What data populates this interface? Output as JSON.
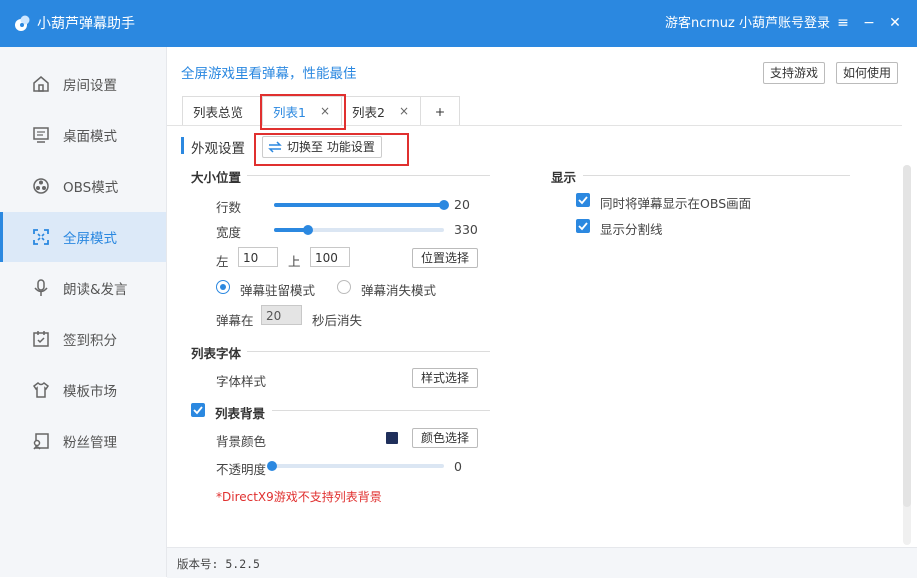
{
  "titlebar": {
    "app_title": "小葫芦弹幕助手",
    "user_name": "游客ncrnuz",
    "login_link": "小葫芦账号登录",
    "menu_glyph": "≡",
    "minimize_glyph": "−",
    "close_glyph": "✕",
    "bg_color": "#2b88e0"
  },
  "sidebar": {
    "items": [
      {
        "label": "房间设置",
        "icon": "house-icon"
      },
      {
        "label": "桌面模式",
        "icon": "monitor-icon"
      },
      {
        "label": "OBS模式",
        "icon": "obs-icon"
      },
      {
        "label": "全屏模式",
        "icon": "fullscreen-icon",
        "active": true
      },
      {
        "label": "朗读&发言",
        "icon": "microphone-icon"
      },
      {
        "label": "签到积分",
        "icon": "calendar-check-icon"
      },
      {
        "label": "模板市场",
        "icon": "tshirt-icon"
      },
      {
        "label": "粉丝管理",
        "icon": "fan-card-icon"
      }
    ]
  },
  "main": {
    "headline": "全屏游戏里看弹幕，性能最佳",
    "support_games_btn": "支持游戏",
    "how_to_use_btn": "如何使用",
    "tabs": [
      {
        "label": "列表总览"
      },
      {
        "label": "列表1",
        "closable": true,
        "active": true
      },
      {
        "label": "列表2",
        "closable": true
      },
      {
        "label": "+"
      }
    ],
    "tab_close_glyph": "×",
    "section_title": "外观设置",
    "switch_btn": "切换至 功能设置",
    "size_position": {
      "title": "大小位置",
      "rows_label": "行数",
      "rows_value": "20",
      "rows_fraction": 1.0,
      "width_label": "宽度",
      "width_value": "330",
      "width_fraction": 0.2,
      "left_label": "左",
      "left_value": "10",
      "top_label": "上",
      "top_value": "100",
      "position_btn": "位置选择",
      "mode_stay": "弹幕驻留模式",
      "mode_vanish": "弹幕消失模式",
      "stay_selected": true,
      "vanish_prefix": "弹幕在",
      "vanish_seconds": "20",
      "vanish_suffix": "秒后消失"
    },
    "list_font": {
      "title": "列表字体",
      "style_label": "字体样式",
      "style_btn": "样式选择"
    },
    "list_bg": {
      "title": "列表背景",
      "checked": true,
      "color_label": "背景颜色",
      "color": "#1f2f5b",
      "color_btn": "颜色选择",
      "opacity_label": "不透明度",
      "opacity_value": "0",
      "opacity_fraction": 0,
      "warning": "*DirectX9游戏不支持列表背景"
    },
    "display": {
      "title": "显示",
      "show_in_obs": "同时将弹幕显示在OBS画面",
      "show_in_obs_checked": true,
      "show_divider": "显示分割线",
      "show_divider_checked": true
    },
    "version": "版本号: 5.2.5"
  }
}
